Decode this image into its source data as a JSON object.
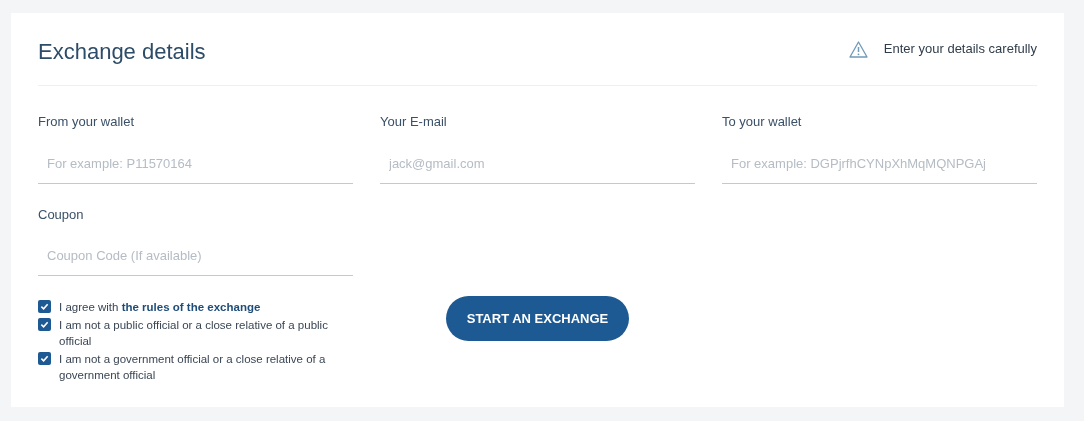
{
  "title": "Exchange details",
  "notice": {
    "text": "Enter your details carefully"
  },
  "fields": [
    {
      "label": "From your wallet",
      "placeholder": "For example: P11570164"
    },
    {
      "label": "Your E-mail",
      "placeholder": "jack@gmail.com"
    },
    {
      "label": "To your wallet",
      "placeholder": "For example: DGPjrfhCYNpXhMqMQNPGAj"
    },
    {
      "label": "Coupon",
      "placeholder": "Coupon Code (If available)"
    }
  ],
  "agreements": [
    {
      "text": "I agree with",
      "link": "the rules of the exchange",
      "checked": true
    },
    {
      "text": "I am not a public official or a close relative of a public official",
      "checked": true
    },
    {
      "text": "I am not a government official or a close relative of a government official",
      "checked": true
    }
  ],
  "button": "START AN EXCHANGE"
}
